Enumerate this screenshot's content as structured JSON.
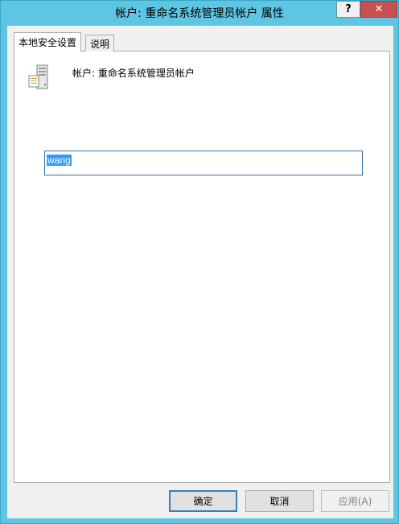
{
  "window": {
    "title": "帐户: 重命名系统管理员帐户 属性",
    "help_label": "?",
    "close_label": "✕"
  },
  "tabs": [
    {
      "label": "本地安全设置",
      "active": true
    },
    {
      "label": "说明",
      "active": false
    }
  ],
  "policy": {
    "icon": "server-policy-icon",
    "title": "帐户: 重命名系统管理员帐户",
    "value": "wang"
  },
  "buttons": {
    "ok": "确定",
    "cancel": "取消",
    "apply": "应用(A)"
  }
}
